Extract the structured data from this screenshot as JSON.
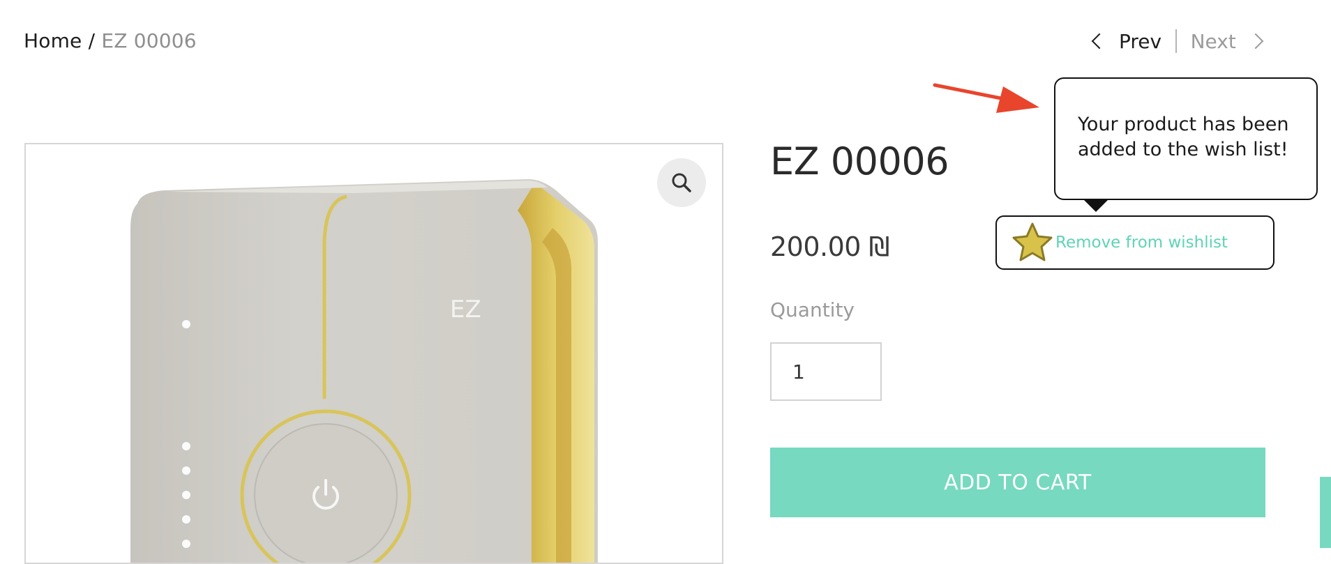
{
  "breadcrumb": {
    "home": "Home",
    "separator": " / ",
    "current": "EZ 00006"
  },
  "pager": {
    "prev": "Prev",
    "next": "Next"
  },
  "product": {
    "title": "EZ 00006",
    "price": "200.00 ₪",
    "quantity_label": "Quantity",
    "quantity_value": "1",
    "add_to_cart": "ADD TO CART",
    "device_logo": "EZ"
  },
  "wishlist": {
    "tooltip": "Your product has been added to the wish list!",
    "remove_label": "Remove from wishlist"
  },
  "colors": {
    "accent": "#76d9c0",
    "wishlist_text": "#5ed3b6",
    "star": "#d9c24a",
    "annotation_arrow": "#e8452c"
  },
  "icons": [
    "search-icon",
    "chevron-left-icon",
    "chevron-right-icon",
    "star-icon",
    "power-icon",
    "arrow-annotation"
  ]
}
